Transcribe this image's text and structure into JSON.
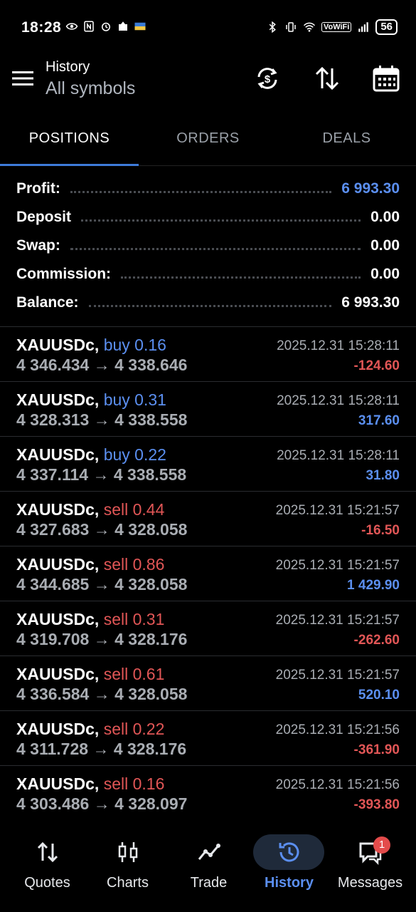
{
  "status": {
    "time": "18:28",
    "wifi_label": "VoWiFi",
    "battery": "56"
  },
  "appbar": {
    "title": "History",
    "subtitle": "All symbols"
  },
  "tabs": [
    {
      "label": "POSITIONS",
      "active": true
    },
    {
      "label": "ORDERS",
      "active": false
    },
    {
      "label": "DEALS",
      "active": false
    }
  ],
  "summary": [
    {
      "label": "Profit:",
      "value": "6 993.30"
    },
    {
      "label": "Deposit",
      "value": "0.00"
    },
    {
      "label": "Swap:",
      "value": "0.00"
    },
    {
      "label": "Commission:",
      "value": "0.00"
    },
    {
      "label": "Balance:",
      "value": "6 993.30"
    }
  ],
  "positions": [
    {
      "symbol": "XAUUSDc,",
      "direction": "buy 0.16",
      "prices": "4 346.434 → 4 338.646",
      "time": "2025.12.31 15:28:11",
      "profit": "-124.60"
    },
    {
      "symbol": "XAUUSDc,",
      "direction": "buy 0.31",
      "prices": "4 328.313 → 4 338.558",
      "time": "2025.12.31 15:28:11",
      "profit": "317.60"
    },
    {
      "symbol": "XAUUSDc,",
      "direction": "buy 0.22",
      "prices": "4 337.114 → 4 338.558",
      "time": "2025.12.31 15:28:11",
      "profit": "31.80"
    },
    {
      "symbol": "XAUUSDc,",
      "direction": "sell 0.44",
      "prices": "4 327.683 → 4 328.058",
      "time": "2025.12.31 15:21:57",
      "profit": "-16.50"
    },
    {
      "symbol": "XAUUSDc,",
      "direction": "sell 0.86",
      "prices": "4 344.685 → 4 328.058",
      "time": "2025.12.31 15:21:57",
      "profit": "1 429.90"
    },
    {
      "symbol": "XAUUSDc,",
      "direction": "sell 0.31",
      "prices": "4 319.708 → 4 328.176",
      "time": "2025.12.31 15:21:57",
      "profit": "-262.60"
    },
    {
      "symbol": "XAUUSDc,",
      "direction": "sell 0.61",
      "prices": "4 336.584 → 4 328.058",
      "time": "2025.12.31 15:21:57",
      "profit": "520.10"
    },
    {
      "symbol": "XAUUSDc,",
      "direction": "sell 0.22",
      "prices": "4 311.728 → 4 328.176",
      "time": "2025.12.31 15:21:56",
      "profit": "-361.90"
    },
    {
      "symbol": "XAUUSDc,",
      "direction": "sell 0.16",
      "prices": "4 303.486 → 4 328.097",
      "time": "2025.12.31 15:21:56",
      "profit": "-393.80"
    }
  ],
  "nav": [
    {
      "label": "Quotes",
      "icon": "quotes-icon"
    },
    {
      "label": "Charts",
      "icon": "candlestick-icon"
    },
    {
      "label": "Trade",
      "icon": "trade-line-icon"
    },
    {
      "label": "History",
      "icon": "history-icon",
      "active": true
    },
    {
      "label": "Messages",
      "icon": "messages-icon",
      "badge": "1"
    }
  ],
  "colors": {
    "accent_blue": "#5b8ff0",
    "sell_red": "#e15656",
    "background": "#000000"
  }
}
